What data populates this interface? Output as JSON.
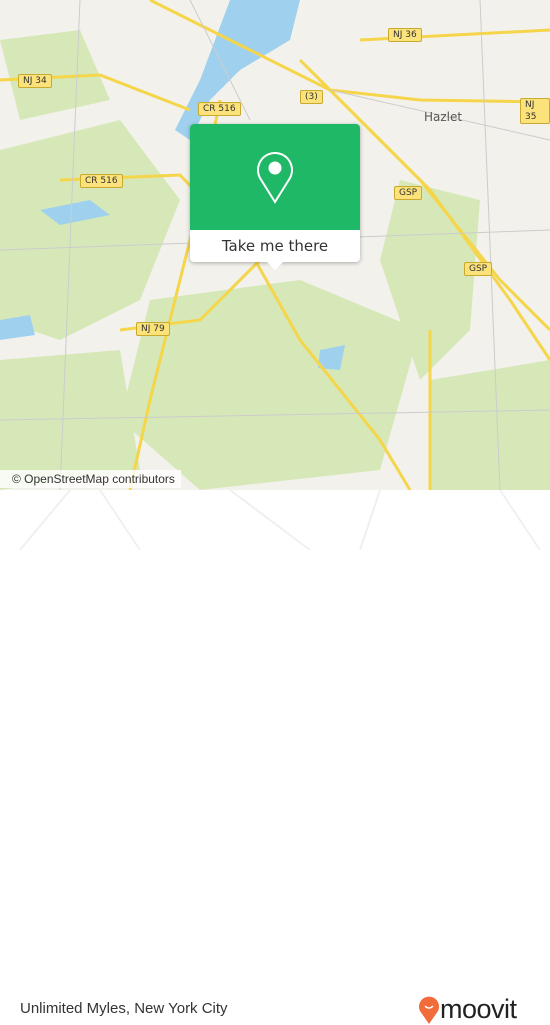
{
  "map": {
    "labels": {
      "nj34": "NJ 34",
      "cr516a": "CR 516",
      "cr516b": "CR 516",
      "r3": "(3)",
      "nj36": "NJ 36",
      "nj35": "NJ 35",
      "gsp1": "GSP",
      "gsp2": "GSP",
      "nj79": "NJ 79",
      "hazlet": "Hazlet"
    },
    "attribution": "© OpenStreetMap contributors",
    "colors": {
      "park": "#d6e8b8",
      "water": "#3a9fd8",
      "road": "#f5d54a",
      "land": "#f3f1ec"
    }
  },
  "popup": {
    "button_label": "Take me there",
    "color": "#1fb867",
    "icon": "map-pin-icon"
  },
  "footer": {
    "title": "Unlimited Myles, New York City",
    "logo_text": "moovit",
    "logo_color": "#f26b3a"
  }
}
